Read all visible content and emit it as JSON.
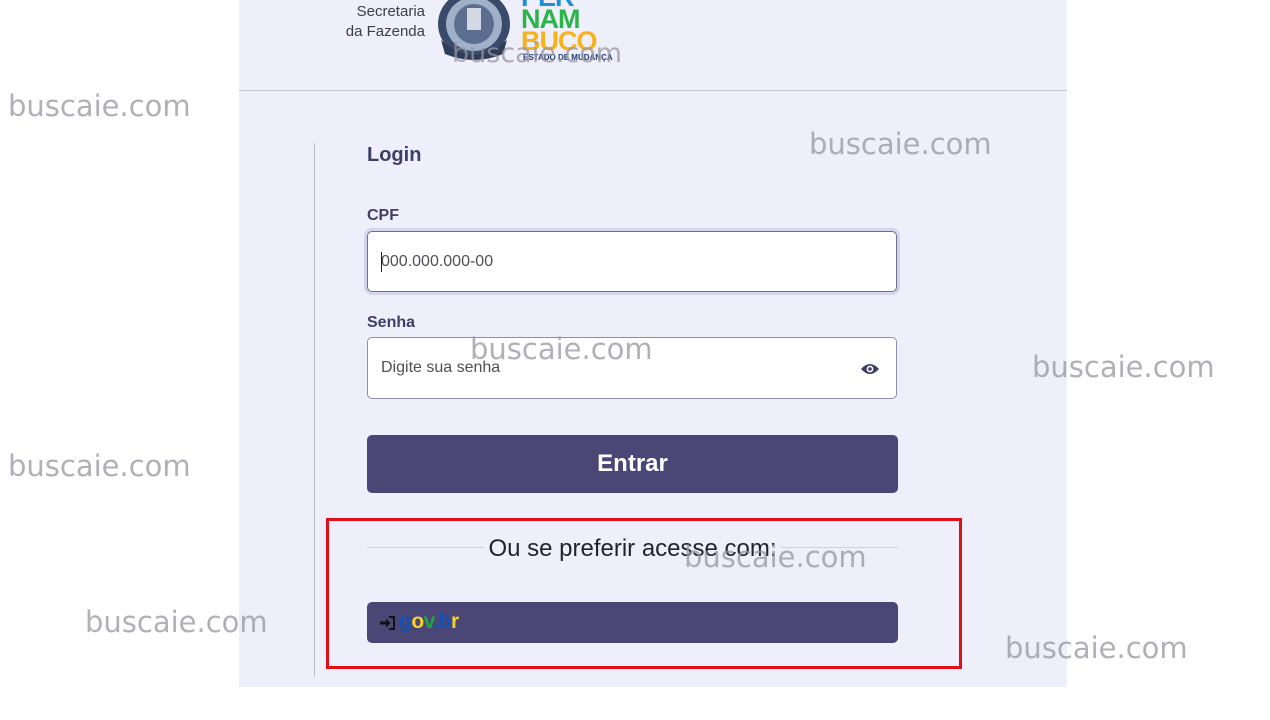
{
  "header": {
    "org_line1": "Secretaria",
    "org_line2": "da Fazenda",
    "state_logo_line1": "PER",
    "state_logo_line2": "NAM",
    "state_logo_line3": "BUCO",
    "state_tagline": "ESTADO DE MUDANÇA"
  },
  "login": {
    "title": "Login",
    "cpf_label": "CPF",
    "cpf_placeholder": "000.000.000-00",
    "senha_label": "Senha",
    "senha_placeholder": "Digite sua senha",
    "submit_label": "Entrar",
    "alt_text": "Ou se preferir acesse com:",
    "govbr_label": "gov.br"
  },
  "watermarks": [
    "buscaie.com",
    "buscaie.com",
    "buscaie.com",
    "buscaie.com",
    "buscaie.com",
    "buscaie.com",
    "buscaie.com",
    "buscaie.com",
    "buscaie.com",
    "buscaie.com"
  ],
  "colors": {
    "panel_bg": "#efeefb",
    "primary": "#4a4676",
    "highlight": "#e0101a",
    "govbr_blue": "#1351b4",
    "govbr_yellow": "#f8d12f",
    "govbr_green": "#1fa543"
  }
}
